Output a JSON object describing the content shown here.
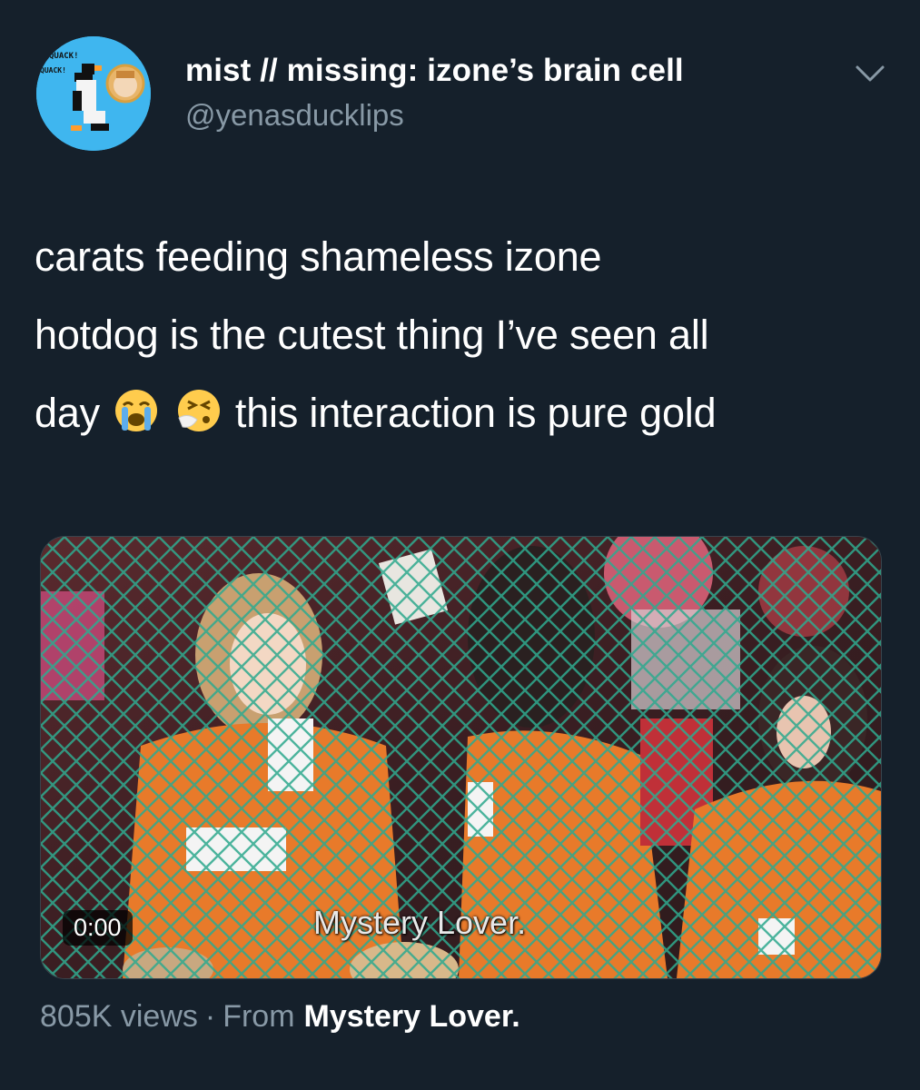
{
  "author": {
    "display_name": "mist // missing: izone’s brain cell",
    "handle": "@yenasducklips",
    "avatar_text_top": "QUACK!",
    "avatar_text_side": "QUACK!"
  },
  "tweet": {
    "line1": "carats feeding shameless izone",
    "line2": "hotdog is the cutest thing I’ve seen all",
    "line3_start": "day",
    "line3_end": "this interaction is pure gold",
    "emojis": [
      "loudly-crying-face",
      "sneezing-face"
    ]
  },
  "media": {
    "timestamp": "0:00",
    "caption": "Mystery Lover.",
    "kind": "video"
  },
  "meta": {
    "views": "805K views",
    "separator": "·",
    "from_label": "From",
    "source": "Mystery Lover."
  },
  "icons": {
    "more": "chevron-down-icon"
  },
  "colors": {
    "background": "#15202b",
    "secondary_text": "#8899a6",
    "primary_text": "#ffffff",
    "avatar_bg": "#3fb6ef"
  }
}
